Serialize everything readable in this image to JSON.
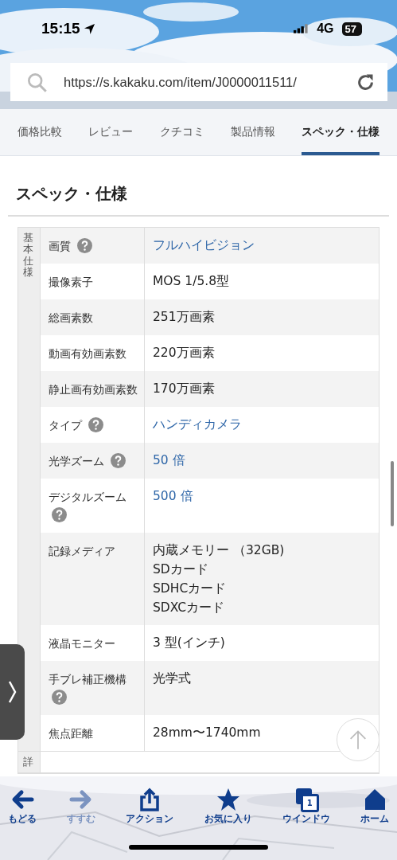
{
  "status_bar": {
    "time": "15:15",
    "network": "4G",
    "battery": "57"
  },
  "address_bar": {
    "url": "https://s.kakaku.com/item/J0000011511/"
  },
  "tabs": [
    {
      "label": "価格比較",
      "selected": false
    },
    {
      "label": "レビュー",
      "selected": false
    },
    {
      "label": "クチコミ",
      "selected": false
    },
    {
      "label": "製品情報",
      "selected": false
    },
    {
      "label": "スペック・仕様",
      "selected": true
    }
  ],
  "heading": "スペック・仕様",
  "spec_sections": [
    {
      "label": "基本仕様",
      "rows": [
        {
          "name": "画質",
          "help": true,
          "link": true,
          "value": [
            "フルハイビジョン"
          ]
        },
        {
          "name": "撮像素子",
          "help": false,
          "link": false,
          "value": [
            "MOS 1/5.8型"
          ]
        },
        {
          "name": "総画素数",
          "help": false,
          "link": false,
          "value": [
            "251万画素"
          ]
        },
        {
          "name": "動画有効画素数",
          "help": false,
          "link": false,
          "value": [
            "220万画素"
          ]
        },
        {
          "name": "静止画有効画素数",
          "help": false,
          "link": false,
          "value": [
            "170万画素"
          ]
        },
        {
          "name": "タイプ",
          "help": true,
          "link": true,
          "value": [
            "ハンディカメラ"
          ]
        },
        {
          "name": "光学ズーム",
          "help": true,
          "link": true,
          "value": [
            "50 倍"
          ]
        },
        {
          "name": "デジタルズーム",
          "help": true,
          "link": true,
          "value": [
            "500 倍"
          ]
        },
        {
          "name": "記録メディア",
          "help": false,
          "link": false,
          "value": [
            "内蔵メモリー （32GB)",
            "SDカード",
            "SDHCカード",
            "SDXCカード"
          ]
        },
        {
          "name": "液晶モニター",
          "help": false,
          "link": false,
          "value": [
            "3 型(インチ)"
          ]
        },
        {
          "name": "手ブレ補正機構",
          "help": true,
          "link": false,
          "value": [
            "光学式"
          ]
        },
        {
          "name": "焦点距離",
          "help": false,
          "link": false,
          "value": [
            "28mm〜1740mm"
          ]
        }
      ]
    },
    {
      "label": "詳"
    }
  ],
  "toolbar": [
    {
      "kind": "back",
      "label": "もどる",
      "disabled": false
    },
    {
      "kind": "forward",
      "label": "すすむ",
      "disabled": true
    },
    {
      "kind": "share",
      "label": "アクション",
      "disabled": false
    },
    {
      "kind": "star",
      "label": "お気に入り",
      "disabled": false
    },
    {
      "kind": "windows",
      "label": "ウインドウ",
      "count": "1",
      "disabled": false
    },
    {
      "kind": "home",
      "label": "ホーム",
      "disabled": false
    }
  ]
}
